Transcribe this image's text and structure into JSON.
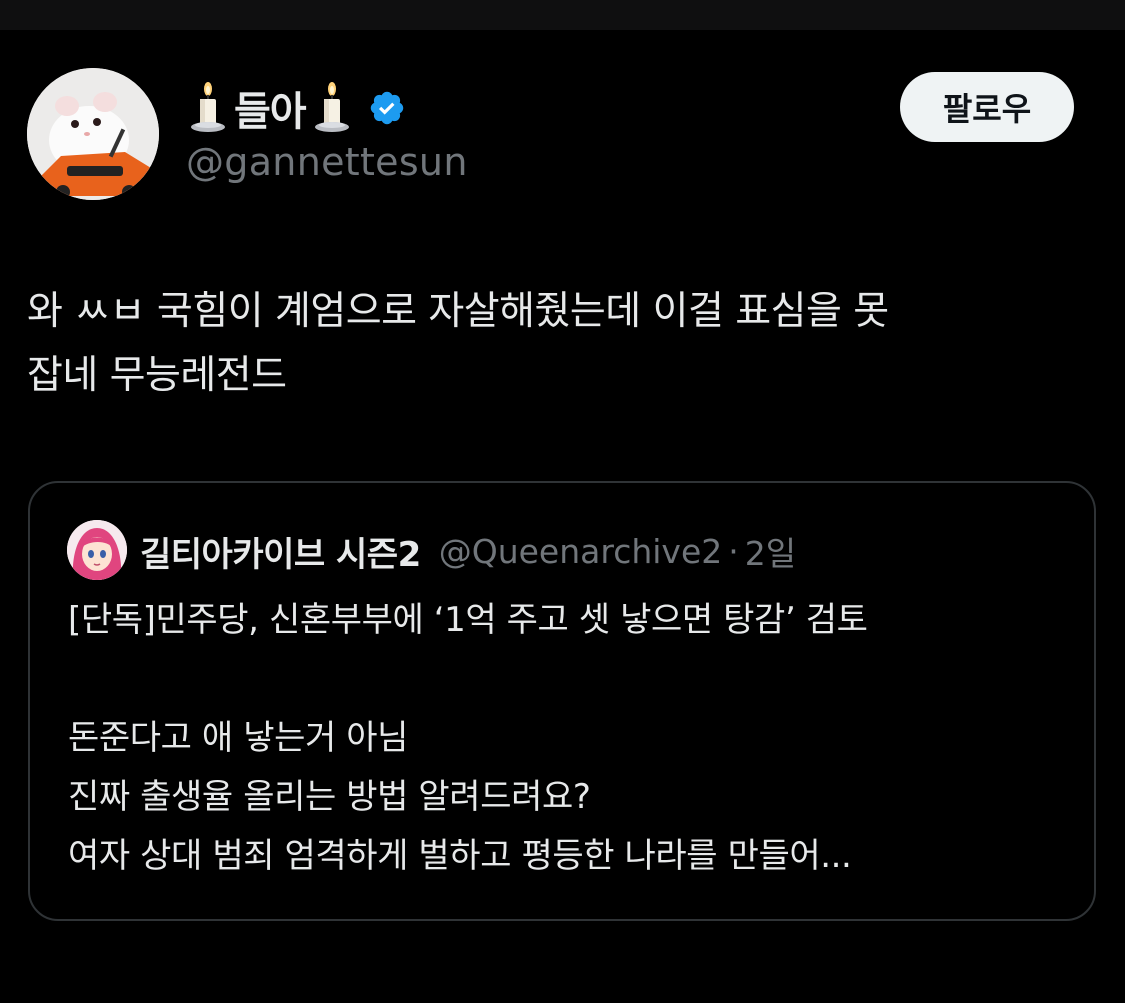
{
  "author": {
    "display_name": "들아",
    "name_emoji": "candle",
    "verified_icon": "verified-badge-icon",
    "handle": "@gannettesun",
    "avatar": "hamster-avatar"
  },
  "follow_button": {
    "label": "팔로우"
  },
  "tweet": {
    "text": "와 ㅆㅂ 국힘이 계엄으로 자살해줬는데 이걸 표심을 못\n잡네 무능레전드"
  },
  "quote": {
    "display_name": "길티아카이브 시즌2",
    "handle": "@Queenarchive2",
    "separator": "·",
    "time": "2일",
    "avatar": "anime-girl-avatar",
    "text": "[단독]민주당, 신혼부부에 ‘1억 주고 셋 낳으면 탕감’ 검토\n\n돈준다고 애 낳는거 아님\n진짜 출생율 올리는 방법 알려드려요?\n여자 상대 범죄 엄격하게 벌하고 평등한 나라를 만들어..."
  },
  "colors": {
    "background": "#000000",
    "text": "#e7e9ea",
    "muted": "#71767b",
    "border": "#2f3336",
    "verified": "#1d9bf0",
    "follow_bg": "#eff3f4"
  }
}
